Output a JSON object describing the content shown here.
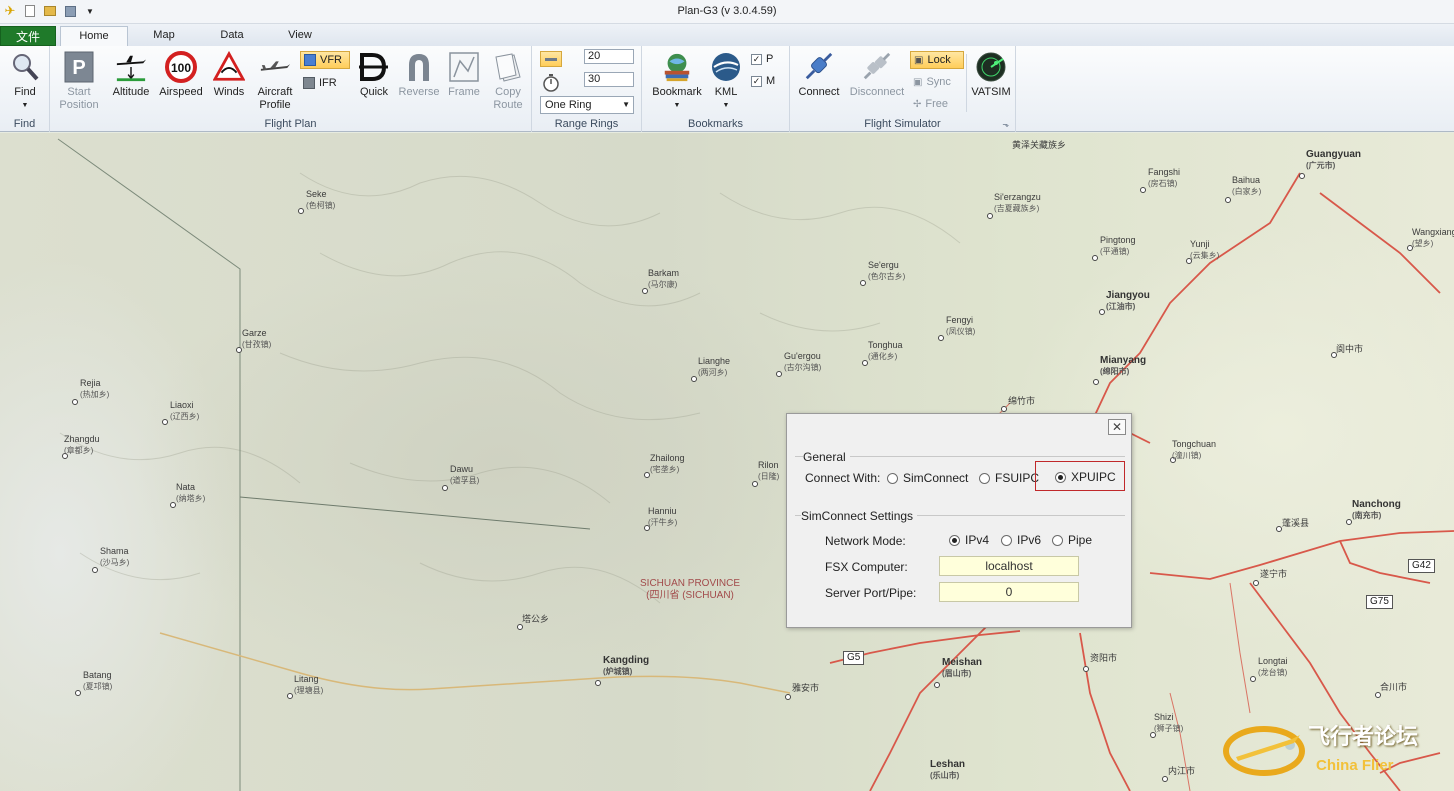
{
  "window": {
    "title": "Plan-G3 (v 3.0.4.59)"
  },
  "tabs": {
    "file": "文件",
    "home": "Home",
    "map": "Map",
    "data": "Data",
    "view": "View"
  },
  "ribbon": {
    "find": {
      "label": "Find",
      "group": "Find"
    },
    "flight_plan": {
      "group": "Flight Plan",
      "start_position": "Start\nPosition",
      "altitude": "Altitude",
      "airspeed": "Airspeed",
      "airspeed_badge": "100",
      "winds": "Winds",
      "aircraft_profile": "Aircraft\nProfile",
      "vfr": "VFR",
      "ifr": "IFR",
      "quick": "Quick",
      "reverse": "Reverse",
      "frame": "Frame",
      "copy_route": "Copy\nRoute"
    },
    "range_rings": {
      "group": "Range Rings",
      "value1": "20",
      "value2": "30",
      "mode": "One Ring"
    },
    "bookmarks": {
      "group": "Bookmarks",
      "bookmark": "Bookmark",
      "kml": "KML",
      "p": "P",
      "m": "M"
    },
    "flight_simulator": {
      "group": "Flight Simulator",
      "connect": "Connect",
      "disconnect": "Disconnect",
      "lock": "Lock",
      "sync": "Sync",
      "free": "Free",
      "vatsim": "VATSIM"
    }
  },
  "map": {
    "cities": [
      {
        "name": "Seke",
        "zh": "(色柯镇)"
      },
      {
        "name": "Garze",
        "zh": "(甘孜镇)"
      },
      {
        "name": "Rejia",
        "zh": "(热加乡)"
      },
      {
        "name": "Liaoxi",
        "zh": "(辽西乡)"
      },
      {
        "name": "Zhangdu",
        "zh": "(章都乡)"
      },
      {
        "name": "Nata",
        "zh": "(纳塔乡)"
      },
      {
        "name": "Shama",
        "zh": "(沙马乡)"
      },
      {
        "name": "Batang",
        "zh": "(夏邛镇)"
      },
      {
        "name": "Litang",
        "zh": "(理塘县)"
      },
      {
        "name": "Dawu",
        "zh": "(道孚县)"
      },
      {
        "name": "Barkam",
        "zh": "(马尔康)"
      },
      {
        "name": "Lianghe",
        "zh": "(两河乡)"
      },
      {
        "name": "Zhailong",
        "zh": "(宅垄乡)"
      },
      {
        "name": "Hanniu",
        "zh": "(汗牛乡)"
      },
      {
        "name": "Kangding",
        "zh": "(炉城镇)"
      },
      {
        "name": "塔公乡",
        "zh": ""
      },
      {
        "name": "Se'ergu",
        "zh": "(色尔古乡)"
      },
      {
        "name": "Gu'ergou",
        "zh": "(古尔沟镇)"
      },
      {
        "name": "Tonghua",
        "zh": "(通化乡)"
      },
      {
        "name": "Fengyi",
        "zh": "(凤仪镇)"
      },
      {
        "name": "Si'erzangzu",
        "zh": "(吉夏藏族乡)"
      },
      {
        "name": "Fangshi",
        "zh": "(房石镇)"
      },
      {
        "name": "Pingtong",
        "zh": "(平通镇)"
      },
      {
        "name": "Yunji",
        "zh": "(云集乡)"
      },
      {
        "name": "Guangyuan",
        "zh": "(广元市)"
      },
      {
        "name": "Baihua",
        "zh": "(白家乡)"
      },
      {
        "name": "Wangxiang",
        "zh": "(望乡)"
      },
      {
        "name": "Jiangyou",
        "zh": "(江油市)"
      },
      {
        "name": "Mianyang",
        "zh": "(绵阳市)"
      },
      {
        "name": "绵竹市",
        "zh": ""
      },
      {
        "name": "阆中市",
        "zh": ""
      },
      {
        "name": "Tongchuan",
        "zh": "(潼川镇)"
      },
      {
        "name": "Nanchong",
        "zh": "(南充市)"
      },
      {
        "name": "蓬溪县",
        "zh": ""
      },
      {
        "name": "遂宁市",
        "zh": ""
      },
      {
        "name": "Meishan",
        "zh": "(眉山市)"
      },
      {
        "name": "资阳市",
        "zh": ""
      },
      {
        "name": "Longtai",
        "zh": "(龙台镇)"
      },
      {
        "name": "合川市",
        "zh": ""
      },
      {
        "name": "雅安市",
        "zh": ""
      },
      {
        "name": "Shizi",
        "zh": "(狮子镇)"
      },
      {
        "name": "Leshan",
        "zh": "(乐山市)"
      },
      {
        "name": "内江市",
        "zh": ""
      },
      {
        "name": "黄泽关藏族乡",
        "zh": ""
      },
      {
        "name": "Rilon",
        "zh": "(日隆)"
      }
    ],
    "roads": [
      "G5",
      "G42",
      "G75"
    ],
    "province": {
      "name": "SICHUAN PROVINCE",
      "zh": "(四川省 (SICHUAN)"
    }
  },
  "dialog": {
    "close": "✕",
    "general_legend": "General",
    "connect_with_label": "Connect With:",
    "options": [
      "SimConnect",
      "FSUIPC",
      "XPUIPC"
    ],
    "selected_option": "XPUIPC",
    "simconnect_legend": "SimConnect Settings",
    "network_mode_label": "Network Mode:",
    "network_modes": [
      "IPv4",
      "IPv6",
      "Pipe"
    ],
    "selected_network_mode": "IPv4",
    "fsx_computer_label": "FSX Computer:",
    "fsx_computer_value": "localhost",
    "server_port_label": "Server Port/Pipe:",
    "server_port_value": "0"
  },
  "watermark": {
    "cn": "飞行者论坛",
    "en": "China Flier"
  },
  "colors": {
    "file_tab": "#1f7a2a",
    "highlight": "#c0282a",
    "input_bg": "#ffffdb",
    "road": "#d8584a"
  }
}
